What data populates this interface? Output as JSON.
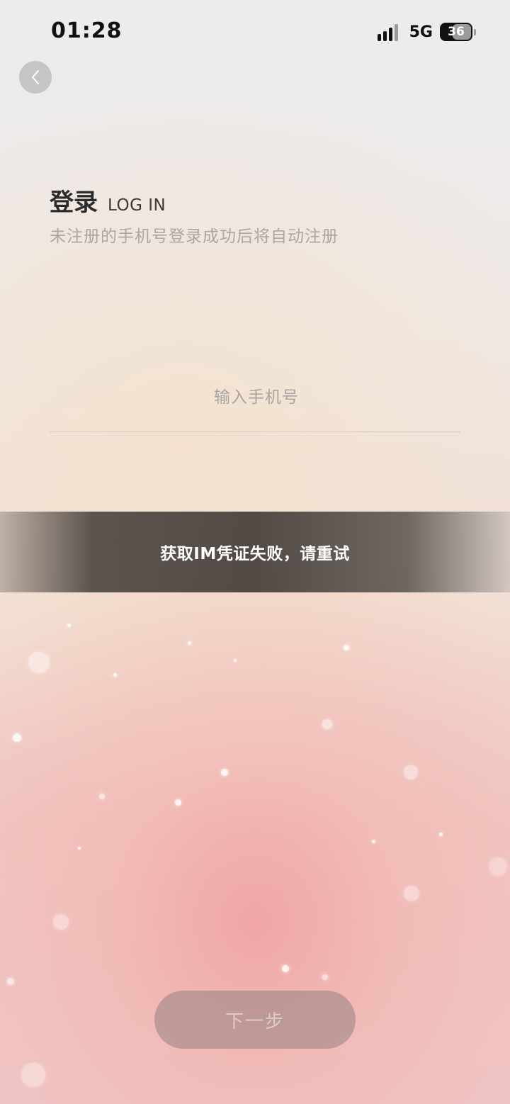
{
  "status_bar": {
    "time": "01:28",
    "network": "5G",
    "battery": "36"
  },
  "header": {
    "title": "登录",
    "subtitle": "LOG IN",
    "hint": "未注册的手机号登录成功后将自动注册"
  },
  "phone": {
    "placeholder": "输入手机号",
    "value": ""
  },
  "toast": {
    "message": "获取IM凭证失败，请重试"
  },
  "next_button": {
    "label": "下一步"
  },
  "icons": {
    "back": "chevron-left-icon",
    "signal": "signal-icon",
    "battery": "battery-icon"
  },
  "colors": {
    "toast_bg": "#4c4440",
    "button_bg": "#968280",
    "hint_text": "#a9a6a5"
  }
}
